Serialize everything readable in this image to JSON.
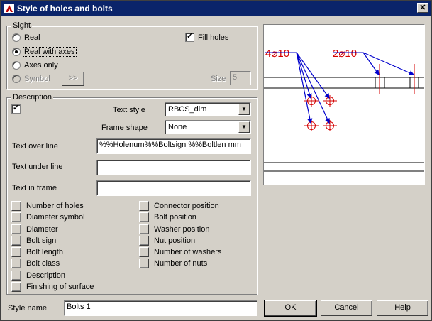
{
  "window": {
    "title": "Style of holes and bolts",
    "close_glyph": "✕"
  },
  "sight": {
    "legend": "Sight",
    "radios": [
      {
        "label": "Real",
        "checked": false,
        "enabled": true
      },
      {
        "label": "Real with axes",
        "checked": true,
        "enabled": true
      },
      {
        "label": "Axes only",
        "checked": false,
        "enabled": true
      },
      {
        "label": "Symbol",
        "checked": false,
        "enabled": false
      }
    ],
    "symbol_button": ">>",
    "fill_holes": {
      "label": "Fill holes",
      "checked": true,
      "mark": "✓"
    },
    "size": {
      "label": "Size",
      "value": "5"
    }
  },
  "description": {
    "legend": "Description",
    "enabled_checkbox": {
      "checked": true,
      "mark": "✓"
    },
    "text_style": {
      "label": "Text style",
      "value": "RBCS_dim"
    },
    "frame_shape": {
      "label": "Frame shape",
      "value": "None"
    },
    "text_over_line": {
      "label": "Text over line",
      "value": "%%Holenum%%Boltsign  %%Boltlen mm"
    },
    "text_under_line": {
      "label": "Text under line",
      "value": ""
    },
    "text_in_frame": {
      "label": "Text in frame",
      "value": ""
    },
    "left_buttons": [
      "Number of holes",
      "Diameter symbol",
      "Diameter",
      "Bolt sign",
      "Bolt length",
      "Bolt class",
      "Description",
      "Finishing of surface"
    ],
    "right_buttons": [
      "Connector position",
      "Bolt position",
      "Washer position",
      "Nut position",
      "Number of washers",
      "Number of nuts"
    ]
  },
  "preview": {
    "label_left": "4⌀10",
    "label_right": "2⌀10",
    "accent": "#d40000",
    "arrow": "#0000cc"
  },
  "footer": {
    "style_name_label": "Style name",
    "style_name_value": "Bolts 1",
    "ok": "OK",
    "cancel": "Cancel",
    "help": "Help"
  },
  "icons": {
    "combo_arrow": "▼"
  }
}
